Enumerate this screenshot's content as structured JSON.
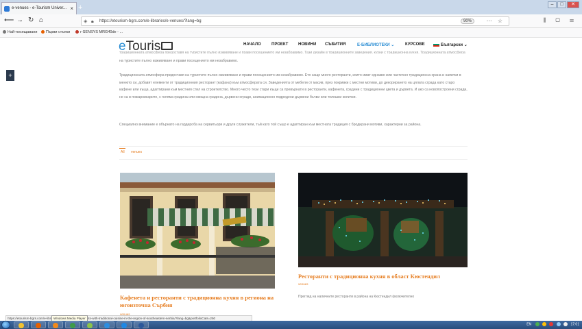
{
  "browser": {
    "tab_title": "e-venues - e-Tourism Univer...",
    "tab_close": "×",
    "new_tab": "+",
    "url": "https://etourism-bgrs.com/e-libraries/e-venues/?lang=bg",
    "zoom": "90%",
    "bookmarks": [
      {
        "label": "Най-посещавани",
        "color": "#777777"
      },
      {
        "label": "Първи стъпки",
        "color": "#e66000"
      },
      {
        "label": "r-SENSYS MRG40de - ...",
        "color": "#c0392b"
      }
    ]
  },
  "site": {
    "logo_e": "e",
    "logo_rest": "Touris",
    "menu": [
      {
        "label": "НАЧАЛО",
        "active": false
      },
      {
        "label": "ПРОЕКТ",
        "active": false
      },
      {
        "label": "НОВИНИ",
        "active": false
      },
      {
        "label": "СЪБИТИЯ",
        "active": false
      },
      {
        "label": "Е-БИБЛИОТЕКИ ⌄",
        "active": true
      },
      {
        "label": "КУРСОВЕ",
        "active": false
      }
    ],
    "language": "Български ⌄"
  },
  "content": {
    "cutline": "традиционната атмосфера предоставя на туристите пълно изживяване и прави посещението им незабравимо. Тази дизайн в традиционните заведения, кухни с традиционна кухня. Традиционната атмосфера предоставя",
    "p1_tail": "на туристите пълно изживяване и прави посещението им незабравимо.",
    "p2": "Традиционната атмосфера предоставя на туристите пълно изживяване и прави посещението им незабравимо. Ето защо много ресторанти, които имат еднакво или частично традиционна храна и напитки в менюто си, добавят елементи от традиционния ресторант (кафана) към атмосферата си. Заведенията от мебели от масив, през покривки с местни мотиви, до декорирането на цялата сграда като старо кафене или къща, адаптирани към местния стил на строителство. Много често тези стари къщи са превърнати в ресторанти, кафенета, градини с традиционни цвета и дървета. И ако са новопостроени сгради, не са в пожарникарите, с голяма градина или овощна градина, дървени огради, анимационно подредени дървени бъчви или телешки колички.",
    "p3": "Специално внимание е обърнато на гардероба на сервитьори и други служители, тъй като той също е адаптиран към местната традиция с бродирани мотиви, характерни за района.",
    "filters": [
      "All",
      "venues"
    ]
  },
  "cards": [
    {
      "title": "Кафенета и ресторанти с традиционна кухня в региона на югоизточна Сърбия",
      "sub": "venues"
    },
    {
      "title": "Ресторанти с традиционна кухня в област Кюстендил",
      "sub": "venues",
      "excerpt": "Преглед на наличните ресторанти в района на Кюстендил (включително"
    }
  ],
  "status": {
    "url": "https://etourism-bgrs.com/e-libraries/e-venues/e-restaurants-with-traditional-cuisine-in-the-region-of-southeastern-serbia/?lang=bg&portfolioCats=250",
    "tooltip": "Windows Media Player"
  },
  "taskbar": {
    "time": "17:01",
    "lang": "EN",
    "apps": [
      {
        "name": "explorer",
        "color": "#f2c230"
      },
      {
        "name": "firefox",
        "color": "#e66000"
      },
      {
        "name": "media-player",
        "color": "#f28a1c"
      },
      {
        "name": "chrome",
        "color": "#3e9b48"
      },
      {
        "name": "network",
        "color": "#8bc34a"
      },
      {
        "name": "skype",
        "color": "#2d8ee0"
      },
      {
        "name": "wifi-app",
        "color": "#1e88e5"
      },
      {
        "name": "word",
        "color": "#2b579a"
      }
    ]
  }
}
